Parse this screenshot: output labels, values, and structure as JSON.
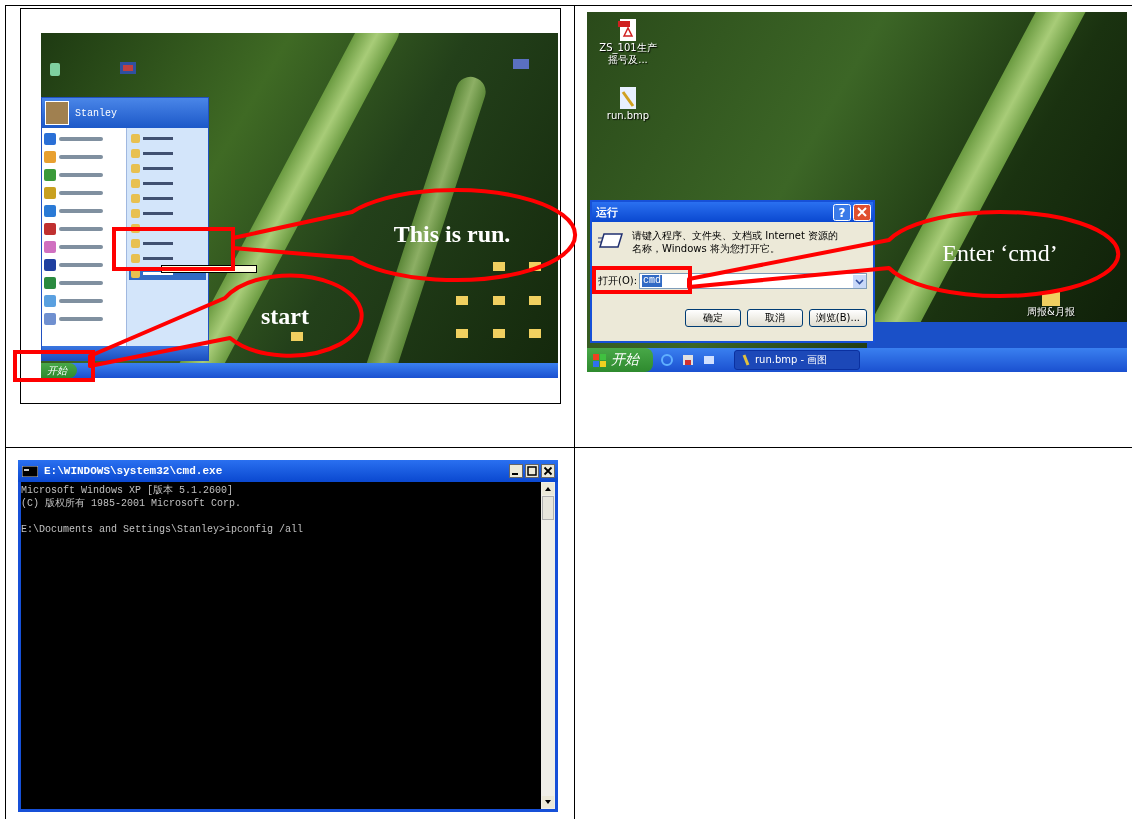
{
  "start_menu_screenshot": {
    "user_name": "Stanley",
    "start_button": "开始",
    "right_column_items": [
      {
        "selected": false
      },
      {
        "selected": false
      },
      {
        "selected": false
      },
      {
        "selected": false
      },
      {
        "selected": false
      },
      {
        "selected": false
      },
      {
        "selected": false
      },
      {
        "selected": false
      },
      {
        "selected": false
      },
      {
        "selected": true
      }
    ],
    "callouts": [
      {
        "text": "This is run."
      },
      {
        "text": "start"
      }
    ]
  },
  "run_dialog_screenshot": {
    "desktop_icons": [
      {
        "kind": "pdf",
        "label_lines": [
          "ZS_101生产",
          "摇号及..."
        ]
      },
      {
        "kind": "bitmap",
        "label_lines": [
          "run.bmp"
        ]
      }
    ],
    "folder_label": "周报&月报",
    "dialog": {
      "title": "运行",
      "help_button": "?",
      "message": "请键入程序、文件夹、文档或 Internet 资源的名称，Windows 将为您打开它。",
      "open_label": "打开(O):",
      "value": "cmd",
      "value_selected": true,
      "buttons": [
        "确定",
        "取消",
        "浏览(B)..."
      ]
    },
    "taskbar": {
      "start_button": "开始",
      "task": "run.bmp - 画图"
    },
    "callout": "Enter ‘cmd’"
  },
  "cmd_screenshot": {
    "title": "E:\\WINDOWS\\system32\\cmd.exe",
    "output_blocks": [
      [
        "Microsoft Windows XP [版本 5.1.2600]",
        "(C) 版权所有 1985-2001 Microsoft Corp."
      ],
      [
        "E:\\Documents and Settings\\Stanley>ipconfig /all"
      ]
    ]
  }
}
